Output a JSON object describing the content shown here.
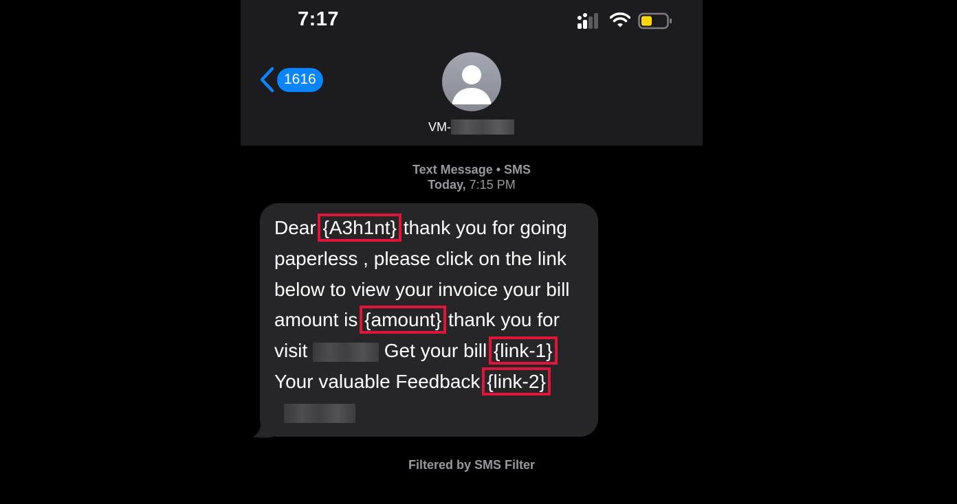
{
  "status_bar": {
    "time": "7:17"
  },
  "nav": {
    "back_label": "1616",
    "contact_prefix": "VM-"
  },
  "thread": {
    "message_type": "Text Message • SMS",
    "date_label": "Today,",
    "time_label": "7:15 PM"
  },
  "message": {
    "t1": "Dear ",
    "name_placeholder": "{A3h1nt}",
    "t2": " thank you for going paperless , please click on the link below to view your invoice your bill amount is ",
    "amount_placeholder": "{amount}",
    "t3": " thank you for visit ",
    "t4": " Get your bill ",
    "link1_placeholder": "{link-1}",
    "t5": ". Your valuable Feedback ",
    "link2_placeholder": "{link-2}"
  },
  "footer": {
    "filter_label": "Filtered by SMS Filter"
  },
  "colors": {
    "accent": "#0a84ff",
    "highlight_box": "#e0153a",
    "battery": "#ffd60a",
    "bubble": "#262628"
  }
}
